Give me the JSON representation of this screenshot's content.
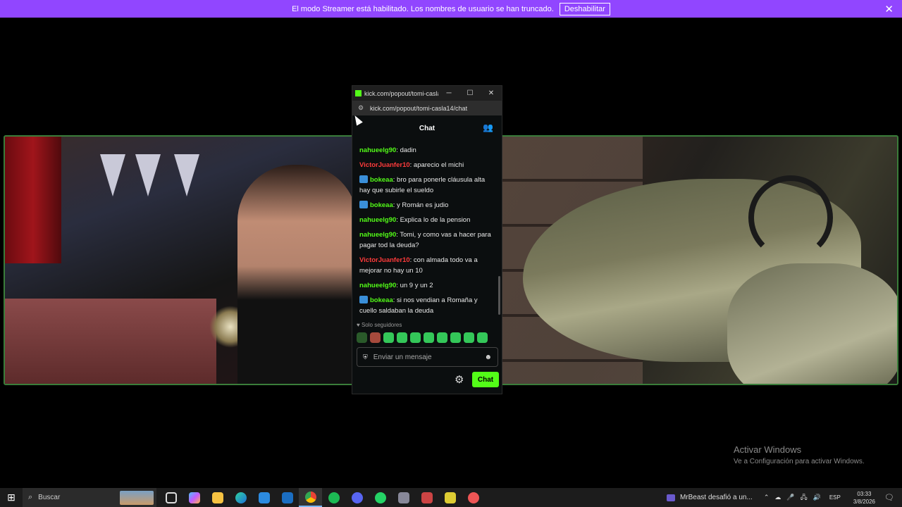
{
  "banner": {
    "message": "El modo Streamer está habilitado. Los nombres de usuario se han truncado.",
    "button": "Deshabilitar",
    "close": "✕"
  },
  "popout": {
    "title": "kick.com/popout/tomi-casla...",
    "url": "kick.com/popout/tomi-casla14/chat",
    "min": "─",
    "max": "☐",
    "close": "✕"
  },
  "chat": {
    "header": "Chat",
    "messages": [
      {
        "user": "nahueelg90",
        "color": "#53fc18",
        "text": "dadin",
        "badge": false
      },
      {
        "user": "VictorJuanfer10",
        "color": "#ff3b3b",
        "text": "aparecio el michi",
        "badge": false
      },
      {
        "user": "bokeaa",
        "color": "#53fc18",
        "text": "bro para ponerle cláusula alta hay que subirle el sueldo",
        "badge": true
      },
      {
        "user": "bokeaa",
        "color": "#53fc18",
        "text": "y Román es judio",
        "badge": true
      },
      {
        "user": "nahueelg90",
        "color": "#53fc18",
        "text": "Explica lo de la pension",
        "badge": false
      },
      {
        "user": "nahueelg90",
        "color": "#53fc18",
        "text": "Tomi, y como vas a hacer para pagar tod la deuda?",
        "badge": false
      },
      {
        "user": "VictorJuanfer10",
        "color": "#ff3b3b",
        "text": "con almada todo va a mejorar no hay un 10",
        "badge": false
      },
      {
        "user": "nahueelg90",
        "color": "#53fc18",
        "text": "un 9 y un 2",
        "badge": false
      },
      {
        "user": "bokeaa",
        "color": "#53fc18",
        "text": "si nos vendian a Romaña y cuello saldaban la deuda",
        "badge": true
      }
    ],
    "followers_only": "♥ Solo seguidores",
    "input_placeholder": "Enviar un mensaje",
    "send_button": "Chat"
  },
  "activate_windows": {
    "title": "Activar Windows",
    "subtitle": "Ve a Configuración para activar Windows."
  },
  "taskbar": {
    "search_label": "Buscar",
    "news": "MrBeast desafió a un...",
    "lang": "ESP",
    "time": "03:33",
    "date": "3/8/2026",
    "icons": [
      "task-view",
      "copilot",
      "file-explorer",
      "edge",
      "store",
      "outlook",
      "chrome",
      "spotify",
      "discord",
      "whatsapp",
      "app-1",
      "app-2",
      "app-3",
      "app-4"
    ]
  }
}
